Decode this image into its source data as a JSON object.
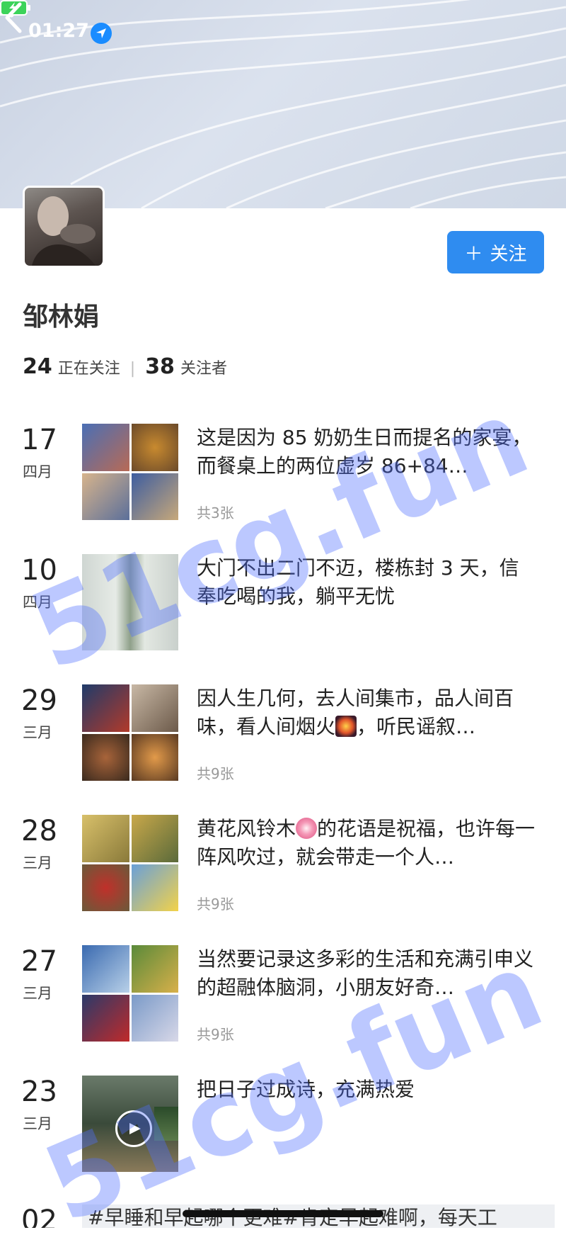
{
  "status_bar": {
    "time": "01:27"
  },
  "profile": {
    "username": "邹林娟",
    "following_count": "24",
    "following_label": "正在关注",
    "followers_count": "38",
    "followers_label": "关注者",
    "follow_button_label": "关注"
  },
  "posts": [
    {
      "day": "17",
      "month": "四月",
      "text": "这是因为 85 奶奶生日而提名的家宴，而餐桌上的两位虚岁 86+84…",
      "count": "共3张"
    },
    {
      "day": "10",
      "month": "四月",
      "text": "大门不出二门不迈，楼栋封 3 天，信奉吃喝的我，躺平无忧",
      "count": ""
    },
    {
      "day": "29",
      "month": "三月",
      "text_before": "因人生几何，去人间集市，品人间百味，看人间烟火",
      "text_after": "，听民谣叙…",
      "count": "共9张"
    },
    {
      "day": "28",
      "month": "三月",
      "text_before": "黄花风铃木",
      "text_after": "的花语是祝福，也许每一阵风吹过，就会带走一个人…",
      "count": "共9张"
    },
    {
      "day": "27",
      "month": "三月",
      "text": "当然要记录这多彩的生活和充满引申义的超融体脑洞，小朋友好奇…",
      "count": "共9张"
    },
    {
      "day": "23",
      "month": "三月",
      "text": "把日子过成诗，充满热爱",
      "count": ""
    },
    {
      "day": "02",
      "month": "",
      "text": "#早睡和早起哪个更难#肯定早起难啊，每天工",
      "count": ""
    }
  ],
  "watermark": {
    "text1": "51cg.fun",
    "text2": "51cg.fun"
  },
  "colors": {
    "accent": "#2f8cf0",
    "watermark": "#506eff"
  }
}
